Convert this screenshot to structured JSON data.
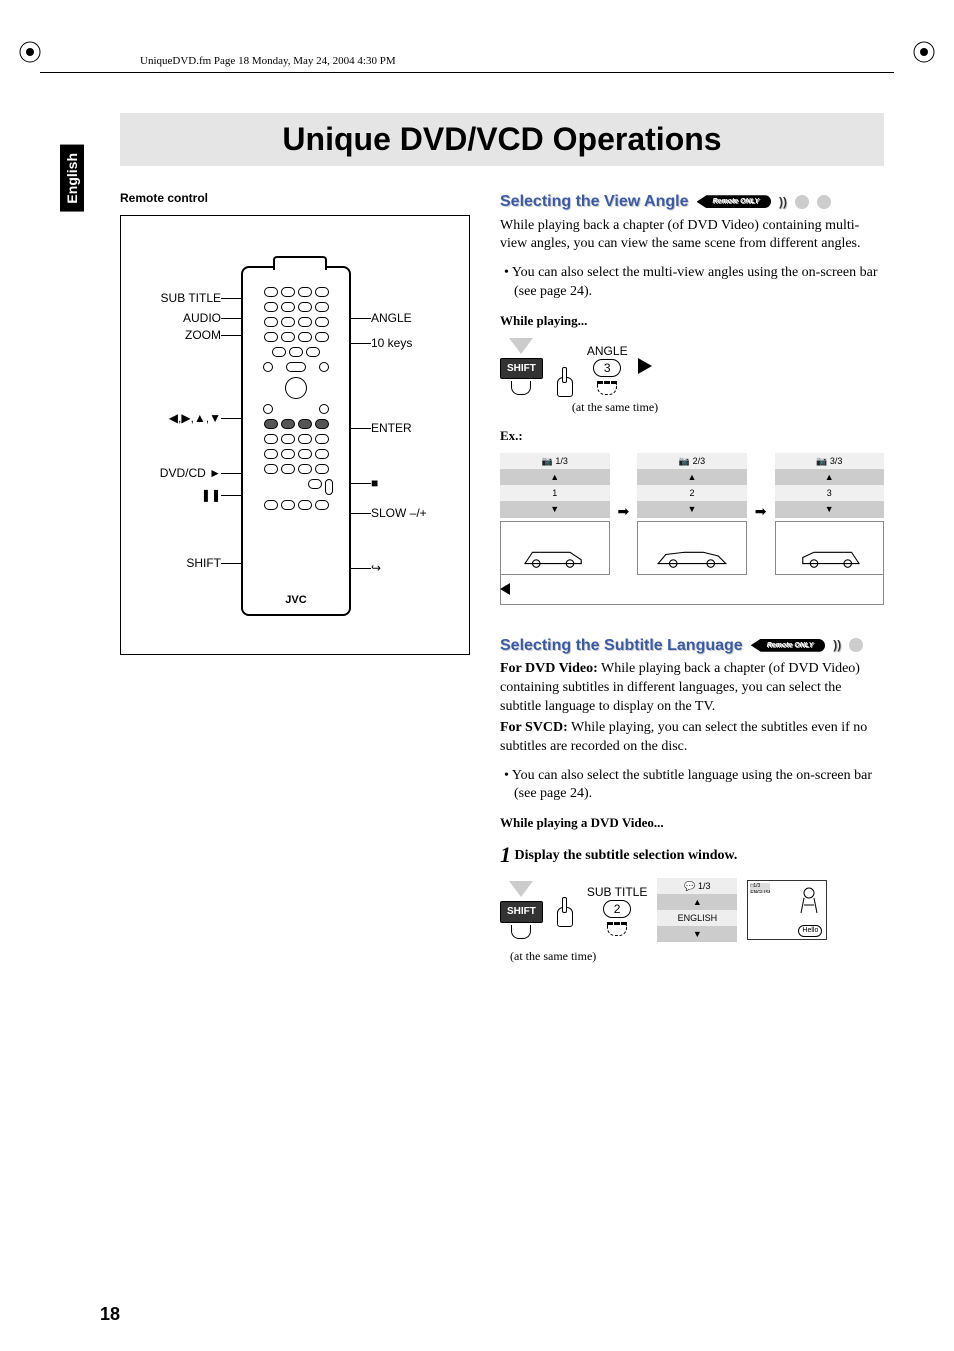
{
  "header_line": "UniqueDVD.fm  Page 18  Monday, May 24, 2004  4:30 PM",
  "language_tab": "English",
  "page_title": "Unique DVD/VCD Operations",
  "remote": {
    "box_title": "Remote control",
    "brand": "JVC",
    "labels_left": {
      "subtitle": "SUB TITLE",
      "audio": "AUDIO",
      "zoom": "ZOOM",
      "cursor": "❮ , ❯ , ❰ ,❱",
      "dvdcd": "DVD/CD ►",
      "pause": "❚❚",
      "shift": "SHIFT"
    },
    "labels_right": {
      "angle": "ANGLE",
      "tenkeys": "10 keys",
      "enter": "ENTER",
      "stop": "■",
      "slow": "SLOW –/+",
      "return": "↩"
    }
  },
  "section_angle": {
    "heading": "Selecting the View Angle",
    "badge": "Remote ONLY",
    "para": "While playing back a chapter (of DVD Video) containing multi-view angles, you can view the same scene from different angles.",
    "bullet": "• You can also select the multi-view angles using the on-screen bar (see page 24).",
    "while_playing": "While playing...",
    "shift_label": "SHIFT",
    "angle_label": "ANGLE",
    "angle_num": "3",
    "same_time": "(at the same time)",
    "ex_label": "Ex.:",
    "ex_cells": [
      {
        "top": "1/3",
        "bottom": "1"
      },
      {
        "top": "2/3",
        "bottom": "2"
      },
      {
        "top": "3/3",
        "bottom": "3"
      }
    ]
  },
  "section_subtitle": {
    "heading": "Selecting the Subtitle Language",
    "badge": "Remote ONLY",
    "para_dvd_label": "For DVD Video:",
    "para_dvd": " While playing back a chapter (of DVD Video) containing subtitles in different languages, you can select the subtitle language to display on the TV.",
    "para_svcd_label": "For SVCD:",
    "para_svcd": " While playing, you can select the subtitles even if no subtitles are recorded on the disc.",
    "bullet": "• You can also select the subtitle language using the on-screen bar (see page 24).",
    "while_playing": "While playing a DVD Video...",
    "step1_num": "1",
    "step1_text": " Display the subtitle selection window.",
    "shift_label": "SHIFT",
    "subtitle_btn_label": "SUB TITLE",
    "subtitle_num": "2",
    "same_time": "(at the same time)",
    "osd_top": "1/3",
    "osd_bottom": "ENGLISH",
    "bubble": "Hello"
  },
  "page_number": "18"
}
